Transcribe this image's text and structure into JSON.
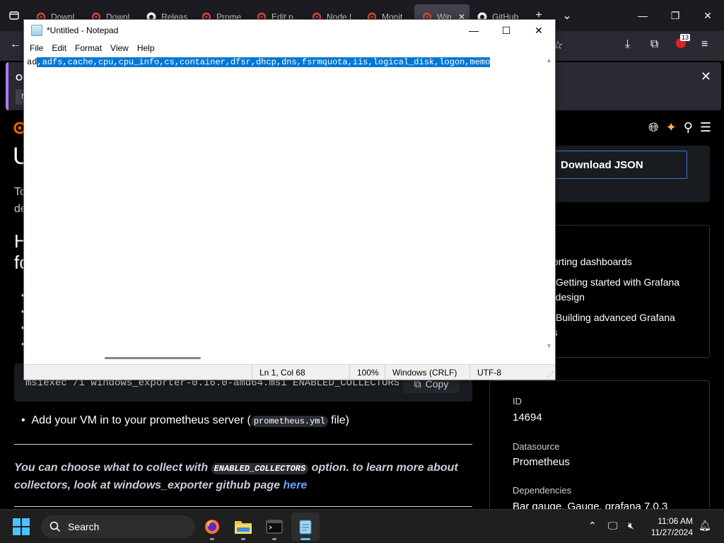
{
  "browser": {
    "tabs": [
      {
        "title": "Downl",
        "icon": "grafana-icon"
      },
      {
        "title": "Downl",
        "icon": "grafana-icon"
      },
      {
        "title": "Releas",
        "icon": "github-icon"
      },
      {
        "title": "Prome",
        "icon": "grafana-icon"
      },
      {
        "title": "Edit p",
        "icon": "grafana-icon"
      },
      {
        "title": "Node |",
        "icon": "grafana-icon"
      },
      {
        "title": "Monit",
        "icon": "grafana-icon"
      },
      {
        "title": "Win",
        "icon": "grafana-icon",
        "active": true
      },
      {
        "title": "GitHub",
        "icon": "github-icon"
      }
    ],
    "extension_badge": "13",
    "notice": {
      "text": "Op",
      "button": "N"
    }
  },
  "grafana": {
    "h1": "U",
    "intro": [
      "To",
      "de"
    ],
    "h2": [
      "H",
      "fo"
    ],
    "download_button": "Download JSON",
    "resources": {
      "heading": "s",
      "items": [
        "porting dashboards",
        "Getting started with Grafana",
        "d design",
        "Building advanced Grafana",
        "ds"
      ]
    },
    "code": "msiexec /i windows_exporter-0.16.0-amd64.msi ENABLED_COLLECTORS=\"a",
    "copy_label": "Copy",
    "bullet": {
      "prefix": "Add your VM in to your prometheus server (",
      "code": "prometheus.yml",
      "suffix": " file)"
    },
    "note": {
      "part1": "You can choose what to collect with ",
      "code": "ENABLED_COLLECTORS",
      "part2": " option. to learn more about collectors, look at windows_exporter github page ",
      "link": "here"
    },
    "info": {
      "id_label": "ID",
      "id_value": "14694",
      "datasource_label": "Datasource",
      "datasource_value": "Prometheus",
      "dependencies_label": "Dependencies",
      "dependencies_value": "Bar gauge, Gauge, grafana 7.0.3"
    }
  },
  "notepad": {
    "title": "*Untitled - Notepad",
    "menu": [
      "File",
      "Edit",
      "Format",
      "View",
      "Help"
    ],
    "text_unselected": "ad",
    "text_selected": ",adfs,cache,cpu,cpu_info,cs,container,dfsr,dhcp,dns,fsrmquota,iis,logical_disk,logon,memo",
    "status": {
      "position": "Ln 1, Col 68",
      "zoom": "100%",
      "line_ending": "Windows (CRLF)",
      "encoding": "UTF-8"
    }
  },
  "taskbar": {
    "search_placeholder": "Search",
    "time": "11:06 AM",
    "date": "11/27/2024"
  }
}
